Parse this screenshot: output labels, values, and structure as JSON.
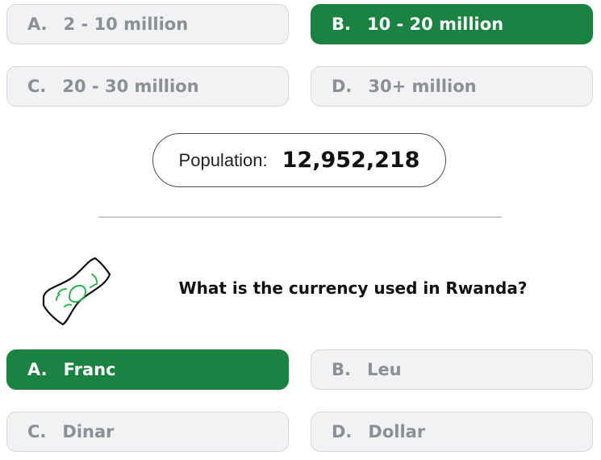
{
  "population_question": {
    "options": [
      {
        "letter": "A.",
        "label": "2 - 10 million",
        "selected": false
      },
      {
        "letter": "B.",
        "label": "10 - 20 million",
        "selected": true
      },
      {
        "letter": "C.",
        "label": "20 - 30 million",
        "selected": false
      },
      {
        "letter": "D.",
        "label": "30+ million",
        "selected": false
      }
    ],
    "result": {
      "label": "Population:",
      "value": "12,952,218"
    }
  },
  "currency_question": {
    "icon": "money-bill-icon",
    "text": "What is the currency used in Rwanda?",
    "options": [
      {
        "letter": "A.",
        "label": "Franc",
        "selected": true
      },
      {
        "letter": "B.",
        "label": "Leu",
        "selected": false
      },
      {
        "letter": "C.",
        "label": "Dinar",
        "selected": false
      },
      {
        "letter": "D.",
        "label": "Dollar",
        "selected": false
      }
    ]
  },
  "colors": {
    "selected": "#1a8341",
    "unselected": "#f1f2f4",
    "unselected_text": "#8c8f93",
    "icon_accent": "#2eb24f"
  }
}
